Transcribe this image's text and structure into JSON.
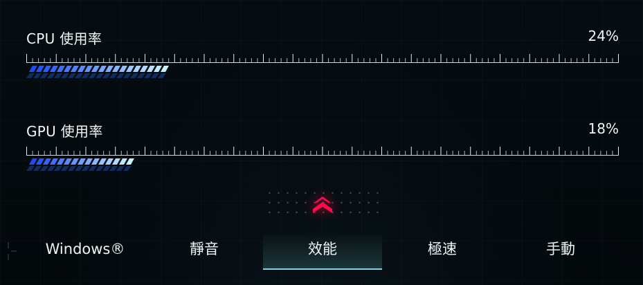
{
  "cpu": {
    "label": "CPU 使用率",
    "value_text": "24%",
    "fraction": 0.24
  },
  "gpu": {
    "label": "GPU 使用率",
    "value_text": "18%",
    "fraction": 0.18
  },
  "modes": {
    "windows": "Windows®",
    "silent": "靜音",
    "performance": "效能",
    "turbo": "極速",
    "manual": "手動"
  },
  "active_mode": "效能",
  "colors": {
    "accent": "#ff0a4a",
    "bar_start": "#1a4cff",
    "bar_end": "#c9f3ff",
    "tab_underline": "#7fd6e4"
  },
  "icons": {
    "performance_mode": "double-chevron-up-icon"
  }
}
